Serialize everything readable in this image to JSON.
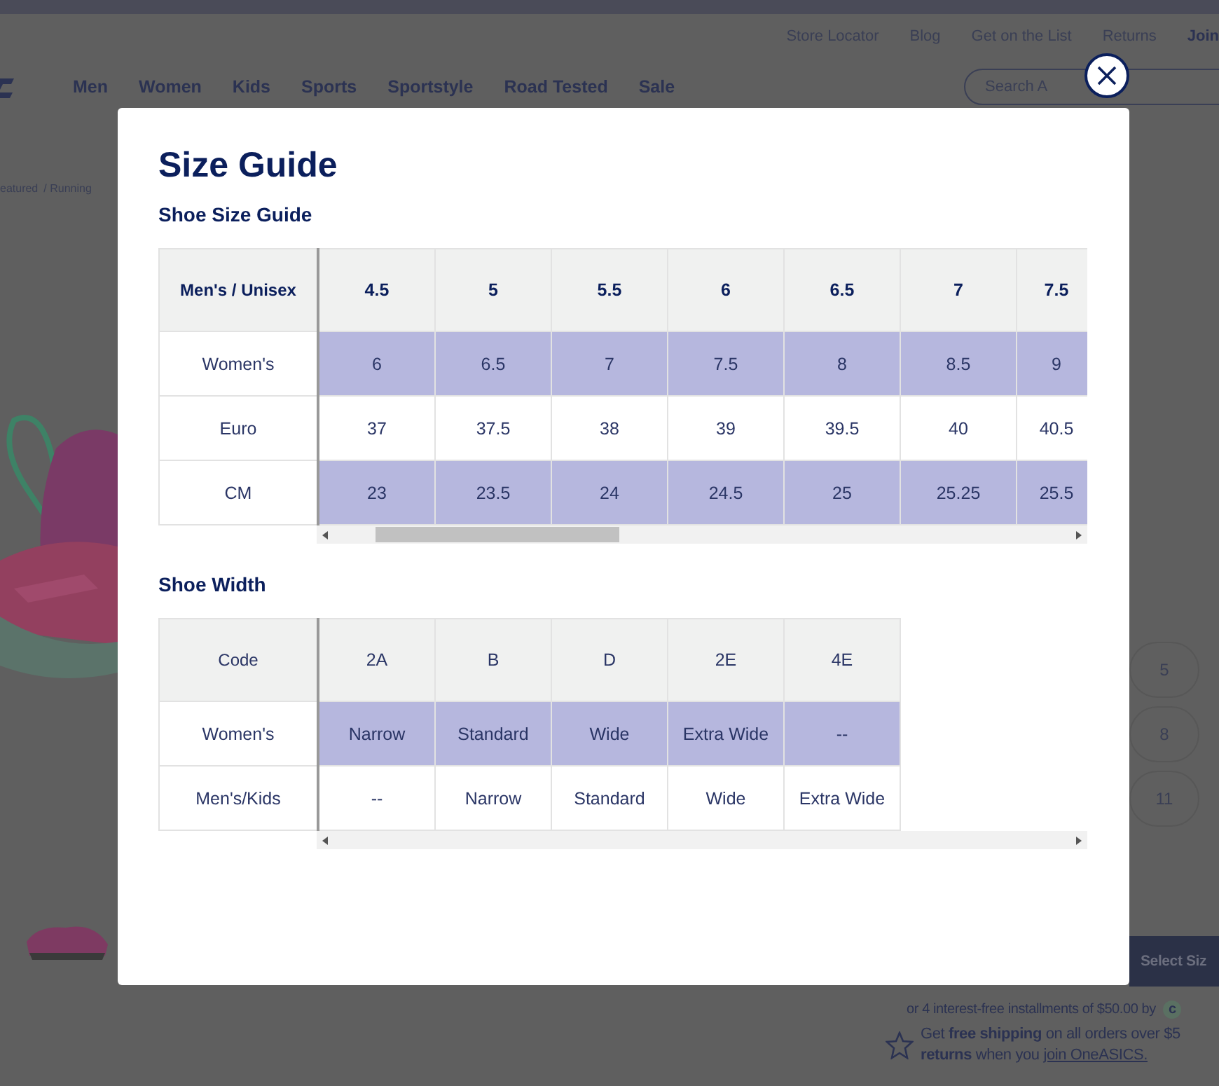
{
  "top_links": [
    "Store Locator",
    "Blog",
    "Get on the List",
    "Returns",
    "Join"
  ],
  "nav": [
    "Men",
    "Women",
    "Kids",
    "Sports",
    "Sportstyle",
    "Road Tested",
    "Sale"
  ],
  "search": {
    "placeholder": "Search A"
  },
  "breadcrumb": [
    "eatured",
    "/ Running"
  ],
  "product": {
    "sizes": [
      "5",
      "8",
      "11"
    ],
    "select_button": "Select Siz",
    "installments": "or 4 interest-free installments of $50.00 by",
    "pay_badge": "c",
    "shipping": "Get **free shipping** on all orders over $5",
    "returns": "**returns** when you",
    "join_link": "join OneASICS."
  },
  "modal": {
    "title": "Size Guide",
    "size_guide": {
      "heading": "Shoe Size Guide",
      "columns": [
        "Men's / Unisex",
        "4.5",
        "5",
        "5.5",
        "6",
        "6.5",
        "7",
        "7.5"
      ],
      "rows": [
        {
          "label": "Women's",
          "highlighted": true,
          "values": [
            "6",
            "6.5",
            "7",
            "7.5",
            "8",
            "8.5",
            "9"
          ]
        },
        {
          "label": "Euro",
          "highlighted": false,
          "values": [
            "37",
            "37.5",
            "38",
            "39",
            "39.5",
            "40",
            "40.5"
          ]
        },
        {
          "label": "CM",
          "highlighted": true,
          "values": [
            "23",
            "23.5",
            "24",
            "24.5",
            "25",
            "25.25",
            "25.5"
          ]
        }
      ]
    },
    "width_guide": {
      "heading": "Shoe Width",
      "columns": [
        "Code",
        "2A",
        "B",
        "D",
        "2E",
        "4E"
      ],
      "rows": [
        {
          "label": "Women's",
          "highlighted": true,
          "values": [
            "Narrow",
            "Standard",
            "Wide",
            "Extra Wide",
            "--"
          ]
        },
        {
          "label": "Men's/Kids",
          "highlighted": false,
          "values": [
            "--",
            "Narrow",
            "Standard",
            "Wide",
            "Extra Wide"
          ]
        }
      ]
    }
  }
}
